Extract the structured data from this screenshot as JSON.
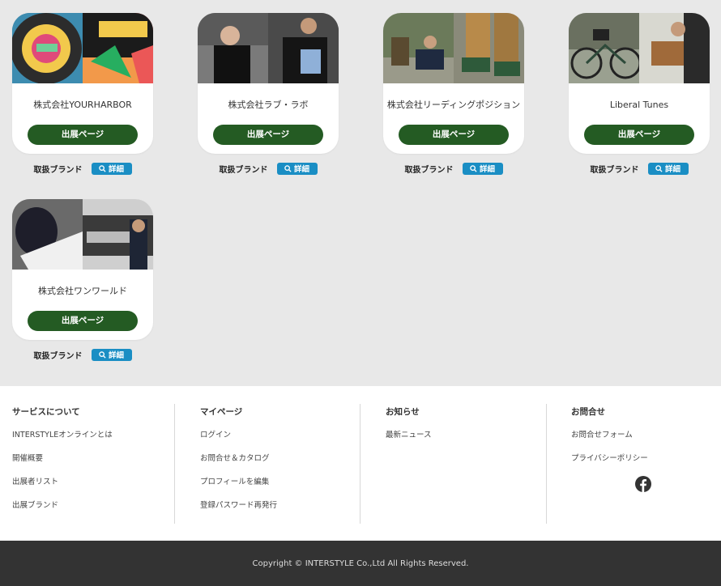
{
  "exhibitors": [
    {
      "name": "株式会社YOURHARBOR",
      "button": "出展ページ",
      "brand_label": "取扱ブランド",
      "detail": "詳細"
    },
    {
      "name": "株式会社ラブ・ラボ",
      "button": "出展ページ",
      "brand_label": "取扱ブランド",
      "detail": "詳細"
    },
    {
      "name": "株式会社リーディングポジション",
      "button": "出展ページ",
      "brand_label": "取扱ブランド",
      "detail": "詳細"
    },
    {
      "name": "Liberal Tunes",
      "button": "出展ページ",
      "brand_label": "取扱ブランド",
      "detail": "詳細"
    },
    {
      "name": "株式会社ワンワールド",
      "button": "出展ページ",
      "brand_label": "取扱ブランド",
      "detail": "詳細"
    }
  ],
  "footer": {
    "services": {
      "heading": "サービスについて",
      "links": [
        "INTERSTYLEオンラインとは",
        "開催概要",
        "出展者リスト",
        "出展ブランド"
      ]
    },
    "mypage": {
      "heading": "マイページ",
      "links": [
        "ログイン",
        "お問合せ＆カタログ",
        "プロフィールを編集",
        "登録パスワード再発行"
      ]
    },
    "news": {
      "heading": "お知らせ",
      "links": [
        "最新ニュース"
      ]
    },
    "contact": {
      "heading": "お問合せ",
      "links": [
        "お問合せフォーム",
        "プライバシーポリシー"
      ]
    },
    "social_icon": "facebook-icon"
  },
  "copyright": "Copyright © INTERSTYLE Co.,Ltd All Rights Reserved.",
  "colors": {
    "page_bg": "#e8e8e8",
    "button_green": "#245b23",
    "detail_blue": "#1a8ec4",
    "footer_dark": "#333333"
  }
}
